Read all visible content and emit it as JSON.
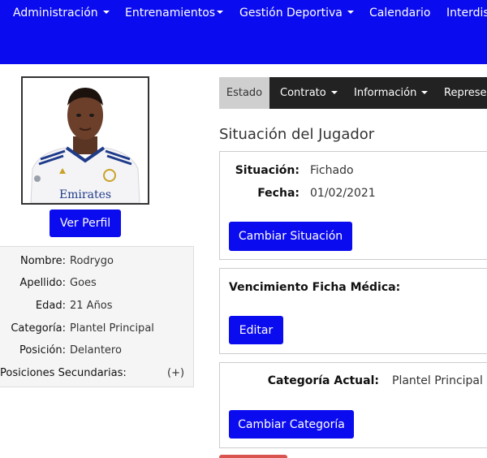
{
  "nav": {
    "items": [
      {
        "label": "Administración",
        "dropdown": true
      },
      {
        "label": "Entrenamientos",
        "dropdown": true
      },
      {
        "label": "Gestión Deportiva",
        "dropdown": true
      },
      {
        "label": "Calendario",
        "dropdown": false
      },
      {
        "label": "Interdis",
        "dropdown": false
      }
    ]
  },
  "profile": {
    "photo_alt": "Foto del jugador",
    "jersey_text": "Emirates",
    "view_profile_label": "Ver Perfil"
  },
  "player": {
    "fields": [
      {
        "label": "Nombre:",
        "value": "Rodrygo"
      },
      {
        "label": "Apellido:",
        "value": "Goes"
      },
      {
        "label": "Edad:",
        "value": "21 Años"
      },
      {
        "label": "Categoría:",
        "value": "Plantel Principal"
      },
      {
        "label": "Posición:",
        "value": "Delantero"
      }
    ],
    "secondary_positions_label": "Posiciones Secundarias:",
    "secondary_positions_toggle": "(+)"
  },
  "tabs": {
    "items": [
      {
        "label": "Estado",
        "active": true,
        "dropdown": false
      },
      {
        "label": "Contrato",
        "active": false,
        "dropdown": true
      },
      {
        "label": "Información",
        "active": false,
        "dropdown": true
      },
      {
        "label": "Represen",
        "active": false,
        "dropdown": false
      }
    ]
  },
  "situacion": {
    "title": "Situación del Jugador",
    "situacion_label": "Situación:",
    "situacion_value": "Fichado",
    "fecha_label": "Fecha:",
    "fecha_value": "01/02/2021",
    "change_button": "Cambiar Situación"
  },
  "medical": {
    "label": "Vencimiento Ficha Médica:",
    "value": "-",
    "edit_button": "Editar"
  },
  "category": {
    "label": "Categoría Actual:",
    "value": "Plantel Principal",
    "change_button": "Cambiar Categoría"
  },
  "colors": {
    "primary": "#0b0bef",
    "tabbar": "#222222",
    "tab_active": "#cfcfcf",
    "danger_strip": "#d9534f"
  }
}
